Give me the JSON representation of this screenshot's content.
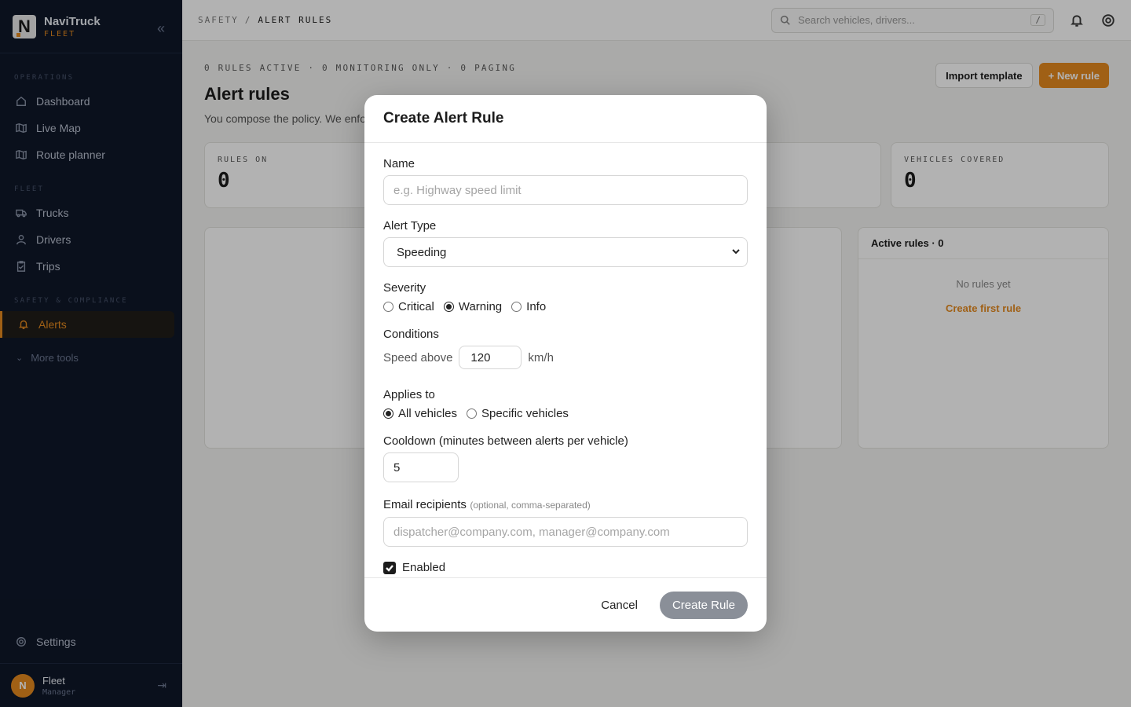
{
  "brand": {
    "name": "NaviTruck",
    "sub": "FLEET",
    "logo_letter": "N"
  },
  "sidebar": {
    "sections": [
      {
        "label": "OPERATIONS"
      },
      {
        "label": "FLEET"
      },
      {
        "label": "SAFETY & COMPLIANCE"
      }
    ],
    "items": [
      {
        "label": "Dashboard",
        "icon": "home-icon"
      },
      {
        "label": "Live Map",
        "icon": "map-icon"
      },
      {
        "label": "Route planner",
        "icon": "route-icon"
      },
      {
        "label": "Trucks",
        "icon": "truck-icon"
      },
      {
        "label": "Drivers",
        "icon": "driver-icon"
      },
      {
        "label": "Trips",
        "icon": "clipboard-icon"
      },
      {
        "label": "Alerts",
        "icon": "bell-icon",
        "active": true
      }
    ],
    "more_tools": "More tools",
    "settings": "Settings",
    "user": {
      "initial": "N",
      "name": "Fleet",
      "role": "Manager"
    }
  },
  "topbar": {
    "crumb_parent": "SAFETY",
    "crumb_sep": "/",
    "crumb_current": "ALERT RULES",
    "search_placeholder": "Search vehicles, drivers...",
    "search_kbd": "/"
  },
  "page": {
    "summary": "0 RULES ACTIVE · 0 MONITORING ONLY · 0 PAGING",
    "title": "Alert rules",
    "subtitle": "You compose the policy. We enfo",
    "import_label": "Import template",
    "new_rule_label": "+ New rule",
    "stats": [
      {
        "label": "RULES ON",
        "value": "0"
      },
      {
        "label": "VEHICLES COVERED",
        "value": "0"
      }
    ],
    "active_rules_title": "Active rules · 0",
    "empty_text": "No rules yet",
    "create_first": "Create first rule"
  },
  "modal": {
    "title": "Create Alert Rule",
    "name_label": "Name",
    "name_placeholder": "e.g. Highway speed limit",
    "type_label": "Alert Type",
    "type_value": "Speeding",
    "severity_label": "Severity",
    "severity_options": [
      "Critical",
      "Warning",
      "Info"
    ],
    "severity_selected": "Warning",
    "conditions_label": "Conditions",
    "speed_prefix": "Speed above",
    "speed_value": "120",
    "speed_unit": "km/h",
    "applies_label": "Applies to",
    "applies_options": [
      "All vehicles",
      "Specific vehicles"
    ],
    "applies_selected": "All vehicles",
    "cooldown_label": "Cooldown (minutes between alerts per vehicle)",
    "cooldown_value": "5",
    "email_label": "Email recipients",
    "email_hint": "(optional, comma-separated)",
    "email_placeholder": "dispatcher@company.com, manager@company.com",
    "enabled_label": "Enabled",
    "enabled": true,
    "cancel_label": "Cancel",
    "create_label": "Create Rule"
  },
  "colors": {
    "accent": "#e58a1f",
    "sidebar_bg": "#0f1729",
    "create_btn": "#8a8f98"
  }
}
